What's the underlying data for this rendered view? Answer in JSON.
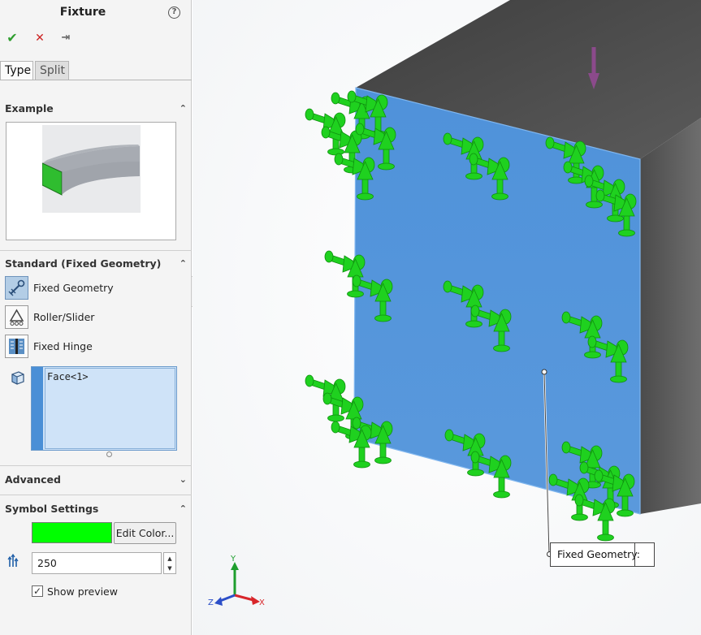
{
  "panel": {
    "title": "Fixture",
    "help_glyph": "?",
    "ok_glyph": "✔",
    "cancel_glyph": "✕",
    "pin_glyph": "⇥",
    "tabs": [
      {
        "label": "Type",
        "active": true
      },
      {
        "label": "Split",
        "active": false
      }
    ],
    "sections": {
      "example": {
        "title": "Example",
        "collapsed": false
      },
      "standard": {
        "title": "Standard (Fixed Geometry)",
        "collapsed": false
      },
      "advanced": {
        "title": "Advanced",
        "collapsed": true
      },
      "symbol": {
        "title": "Symbol Settings",
        "collapsed": false
      }
    },
    "fixture_options": [
      {
        "label": "Fixed Geometry",
        "icon": "fixed-geometry-icon",
        "selected": true
      },
      {
        "label": "Roller/Slider",
        "icon": "roller-slider-icon",
        "selected": false
      },
      {
        "label": "Fixed Hinge",
        "icon": "fixed-hinge-icon",
        "selected": false
      }
    ],
    "selected_entities": [
      "Face<1>"
    ],
    "symbol_color": "#00ff00",
    "edit_color_label": "Edit Color...",
    "symbol_size": "250",
    "show_preview_label": "Show preview",
    "show_preview_checked": true
  },
  "viewport": {
    "callout_label": "Fixed Geometry:",
    "triad": {
      "x": "X",
      "y": "Y",
      "z": "Z"
    },
    "face_color": "#4a90d9",
    "symbol_color": "#1fd11f",
    "load_arrow_color": "#8b4a8b"
  },
  "icons": {
    "chevron_up": "⌃",
    "chevron_down": "⌄",
    "spin_up": "▲",
    "spin_down": "▼",
    "check": "✓"
  }
}
